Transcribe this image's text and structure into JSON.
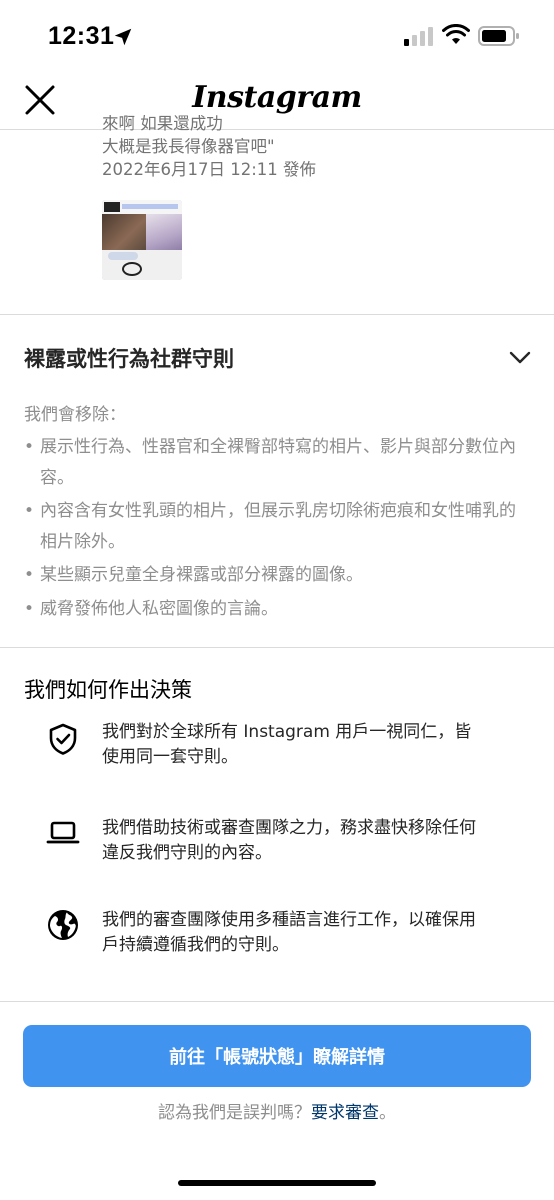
{
  "status_bar": {
    "time": "12:31"
  },
  "header": {
    "title": "Instagram"
  },
  "post_snippet": {
    "lines": [
      "來啊 如果還成功",
      "大概是我長得像器官吧\"",
      "2022年6月17日 12:11 發佈"
    ]
  },
  "guidelines": {
    "title": "裸露或性行為社群守則",
    "intro": "我們會移除：",
    "items": [
      "展示性行為、性器官和全裸臀部特寫的相片、影片與部分數位內容。",
      "內容含有女性乳頭的相片，但展示乳房切除術疤痕和女性哺乳的相片除外。",
      "某些顯示兒童全身裸露或部分裸露的圖像。",
      "威脅發佈他人私密圖像的言論。"
    ]
  },
  "decisions": {
    "title": "我們如何作出決策",
    "items": [
      {
        "icon": "shield-check-icon",
        "text": "我們對於全球所有 Instagram 用戶一視同仁，皆使用同一套守則。"
      },
      {
        "icon": "laptop-icon",
        "text": "我們借助技術或審查團隊之力，務求盡快移除任何違反我們守則的內容。"
      },
      {
        "icon": "globe-icon",
        "text": "我們的審查團隊使用多種語言進行工作，以確保用戶持續遵循我們的守則。"
      }
    ]
  },
  "footer": {
    "cta_label": "前往「帳號狀態」瞭解詳情",
    "appeal_prefix": "認為我們是誤判嗎？",
    "appeal_link": "要求審查",
    "appeal_suffix": "。"
  },
  "colors": {
    "accent": "#4193f0",
    "link": "#00376b",
    "muted": "#8e8e8e"
  }
}
